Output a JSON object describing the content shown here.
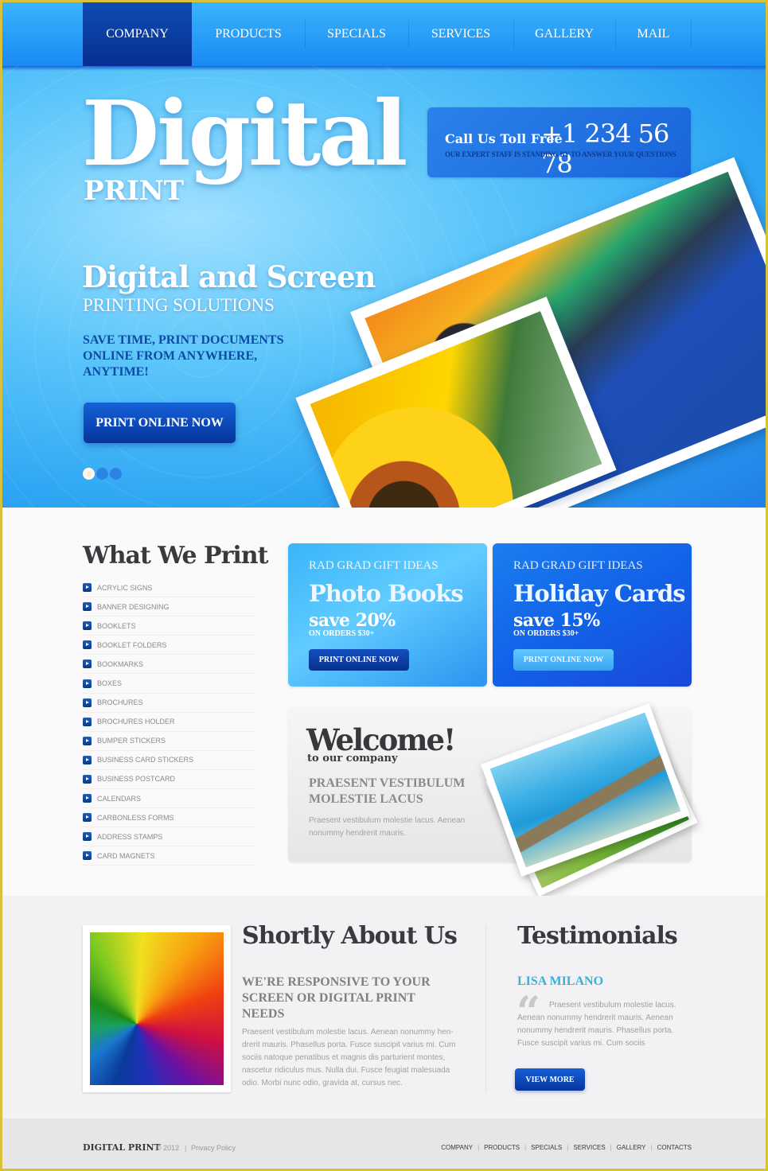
{
  "nav": {
    "items": [
      {
        "label": "COMPANY",
        "active": true
      },
      {
        "label": "PRODUCTS"
      },
      {
        "label": "SPECIALS"
      },
      {
        "label": "SERVICES"
      },
      {
        "label": "GALLERY"
      },
      {
        "label": "MAIL"
      }
    ]
  },
  "hero": {
    "logo_main": "Digital",
    "logo_sub": "PRINT",
    "call_label": "Call Us Toll Free",
    "call_number": "+1 234 56 78",
    "call_sub": "OUR EXPERT STAFF IS STANDING BY TO ANSWER YOUR QUESTIONS",
    "headline": "Digital and Screen",
    "subheadline": "PRINTING SOLUTIONS",
    "tagline": "SAVE TIME, PRINT DOCUMENTS ONLINE FROM ANYWHERE, ANYTIME!",
    "cta": "PRINT ONLINE NOW",
    "slides": {
      "count": 3,
      "active_index": 0
    }
  },
  "what_we_print": {
    "title": "What We Print",
    "items": [
      "ACRYLIC SIGNS",
      "BANNER DESIGNING",
      "BOOKLETS",
      "BOOKLET FOLDERS",
      "BOOKMARKS",
      "BOXES",
      "BROCHURES",
      "BROCHURES HOLDER",
      "BUMPER STICKERS",
      "BUSINESS CARD STICKERS",
      "BUSINESS POSTCARD",
      "CALENDARS",
      "CARBONLESS FORMS",
      "ADDRESS STAMPS",
      "CARD MAGNETS"
    ]
  },
  "promos": [
    {
      "kicker": "RAD GRAD GIFT IDEAS",
      "title": "Photo Books",
      "save": "save 20%",
      "orders": "ON ORDERS $30+",
      "button": "PRINT ONLINE NOW"
    },
    {
      "kicker": "RAD GRAD GIFT IDEAS",
      "title": "Holiday Cards",
      "save": "save 15%",
      "orders": "ON ORDERS $30+",
      "button": "PRINT ONLINE NOW"
    }
  ],
  "welcome": {
    "title": "Welcome!",
    "subtitle": "to our company",
    "heading": "PRAESENT VESTIBULUM MOLESTIE LACUS",
    "body": "Praesent vestibulum molestie lacus. Aenean nonummy hendrerit mauris."
  },
  "about": {
    "title": "Shortly About Us",
    "heading": "WE'RE RESPONSIVE TO YOUR SCREEN OR DIGITAL PRINT NEEDS",
    "body": "Praesent vestibulum molestie lacus. Aenean nonummy hen-drerit mauris. Phasellus porta. Fusce suscipit varius mi. Cum sociis natoque penatibus et magnis dis parturient montes, nascetur ridiculus mus. Nulla dui. Fusce feugiat malesuada odio. Morbi nunc odio, gravida at, cursus nec."
  },
  "testimonials": {
    "title": "Testimonials",
    "name": "LISA MILANO",
    "quote_icon": "“",
    "quote": "Praesent vestibulum molestie lacus. Aenean nonummy hendrerit mauris. Aenean nonummy hendrerit mauris. Phasellus porta. Fusce suscipit varius mi. Cum sociis",
    "button": "VIEW MORE"
  },
  "footer": {
    "brand": "DIGITAL PRINT",
    "copyright": "© 2012",
    "separator": "|",
    "privacy": "Privacy Policy",
    "links": [
      "COMPANY",
      "PRODUCTS",
      "SPECIALS",
      "SERVICES",
      "GALLERY",
      "CONTACTS"
    ]
  },
  "colors": {
    "nav_blue": "#1a8af3",
    "nav_active": "#072f91",
    "accent_dark": "#06349c",
    "testimonial_name": "#3ab0d8",
    "page_border": "#d8c23a"
  }
}
